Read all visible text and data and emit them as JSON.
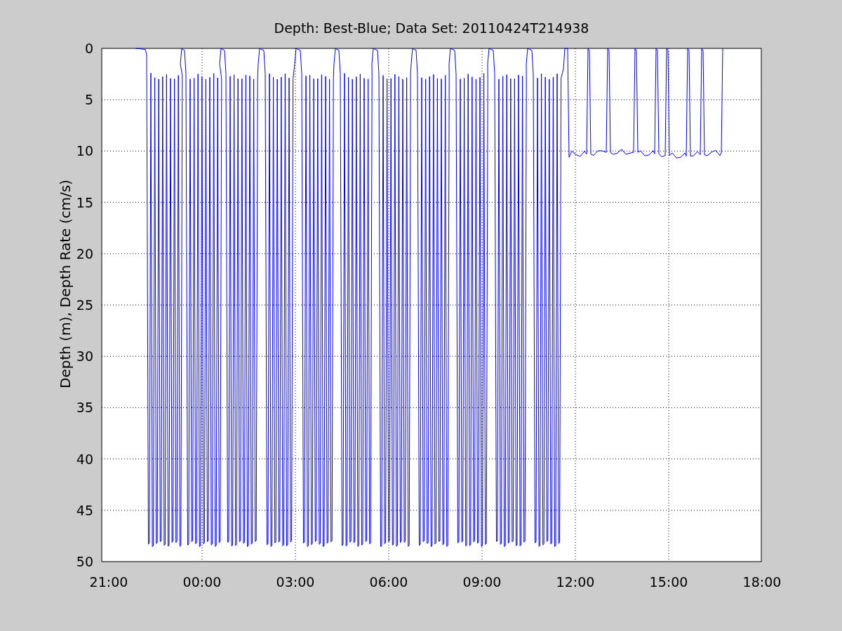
{
  "figure": {
    "title": "Depth: Best-Blue; Data Set: 20110424T214938",
    "ylabel": "Depth (m), Depth Rate (cm/s)",
    "yticks": [
      "0",
      "5",
      "10",
      "15",
      "20",
      "25",
      "30",
      "35",
      "40",
      "45",
      "50"
    ],
    "xticks": [
      "21:00",
      "00:00",
      "03:00",
      "06:00",
      "09:00",
      "12:00",
      "15:00",
      "18:00"
    ]
  }
}
